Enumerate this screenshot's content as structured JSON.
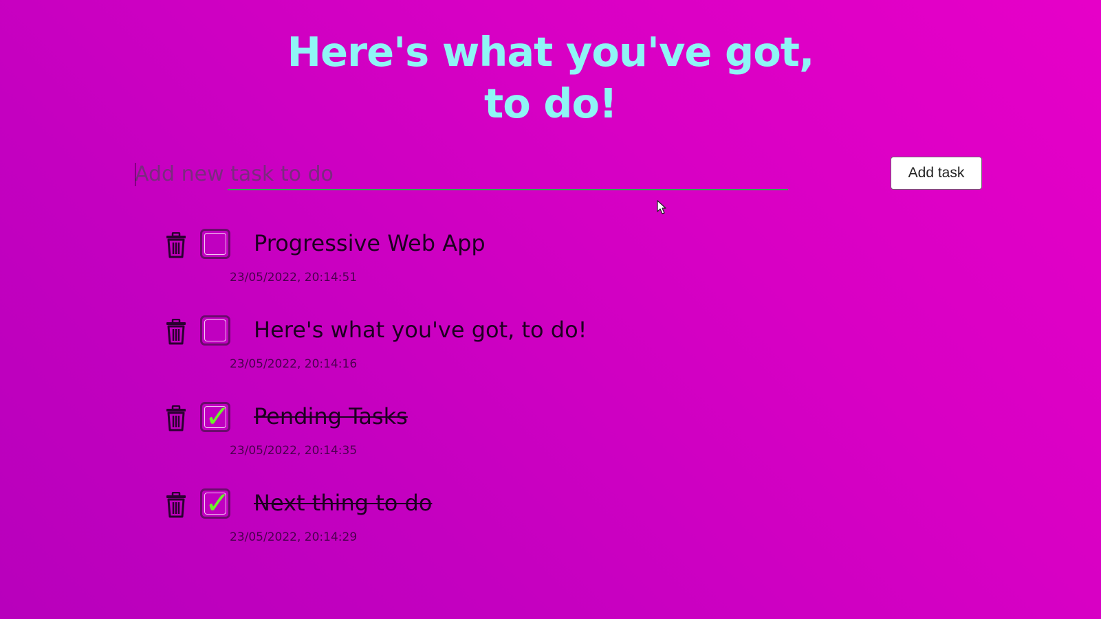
{
  "header": {
    "title_line1": "Here's what you've got,",
    "title_line2": "to do!"
  },
  "form": {
    "input_placeholder": "Add new task to do",
    "input_value": "",
    "add_button_label": "Add task"
  },
  "tasks": [
    {
      "text": "Progressive Web App",
      "timestamp": "23/05/2022, 20:14:51",
      "done": false
    },
    {
      "text": "Here's what you've got, to do!",
      "timestamp": "23/05/2022, 20:14:16",
      "done": false
    },
    {
      "text": "Pending Tasks",
      "timestamp": "23/05/2022, 20:14:35",
      "done": true
    },
    {
      "text": "Next thing to do",
      "timestamp": "23/05/2022, 20:14:29",
      "done": true
    }
  ],
  "icons": {
    "delete": "trash-icon",
    "checked": "check-mark-icon",
    "pointer": "mouse-cursor-icon"
  },
  "colors": {
    "title": "#8ff5f5",
    "background": "#d000c4",
    "input_underline": "#2fa84f",
    "check_mark": "#6cf22a",
    "task_text": "#1d0020"
  }
}
